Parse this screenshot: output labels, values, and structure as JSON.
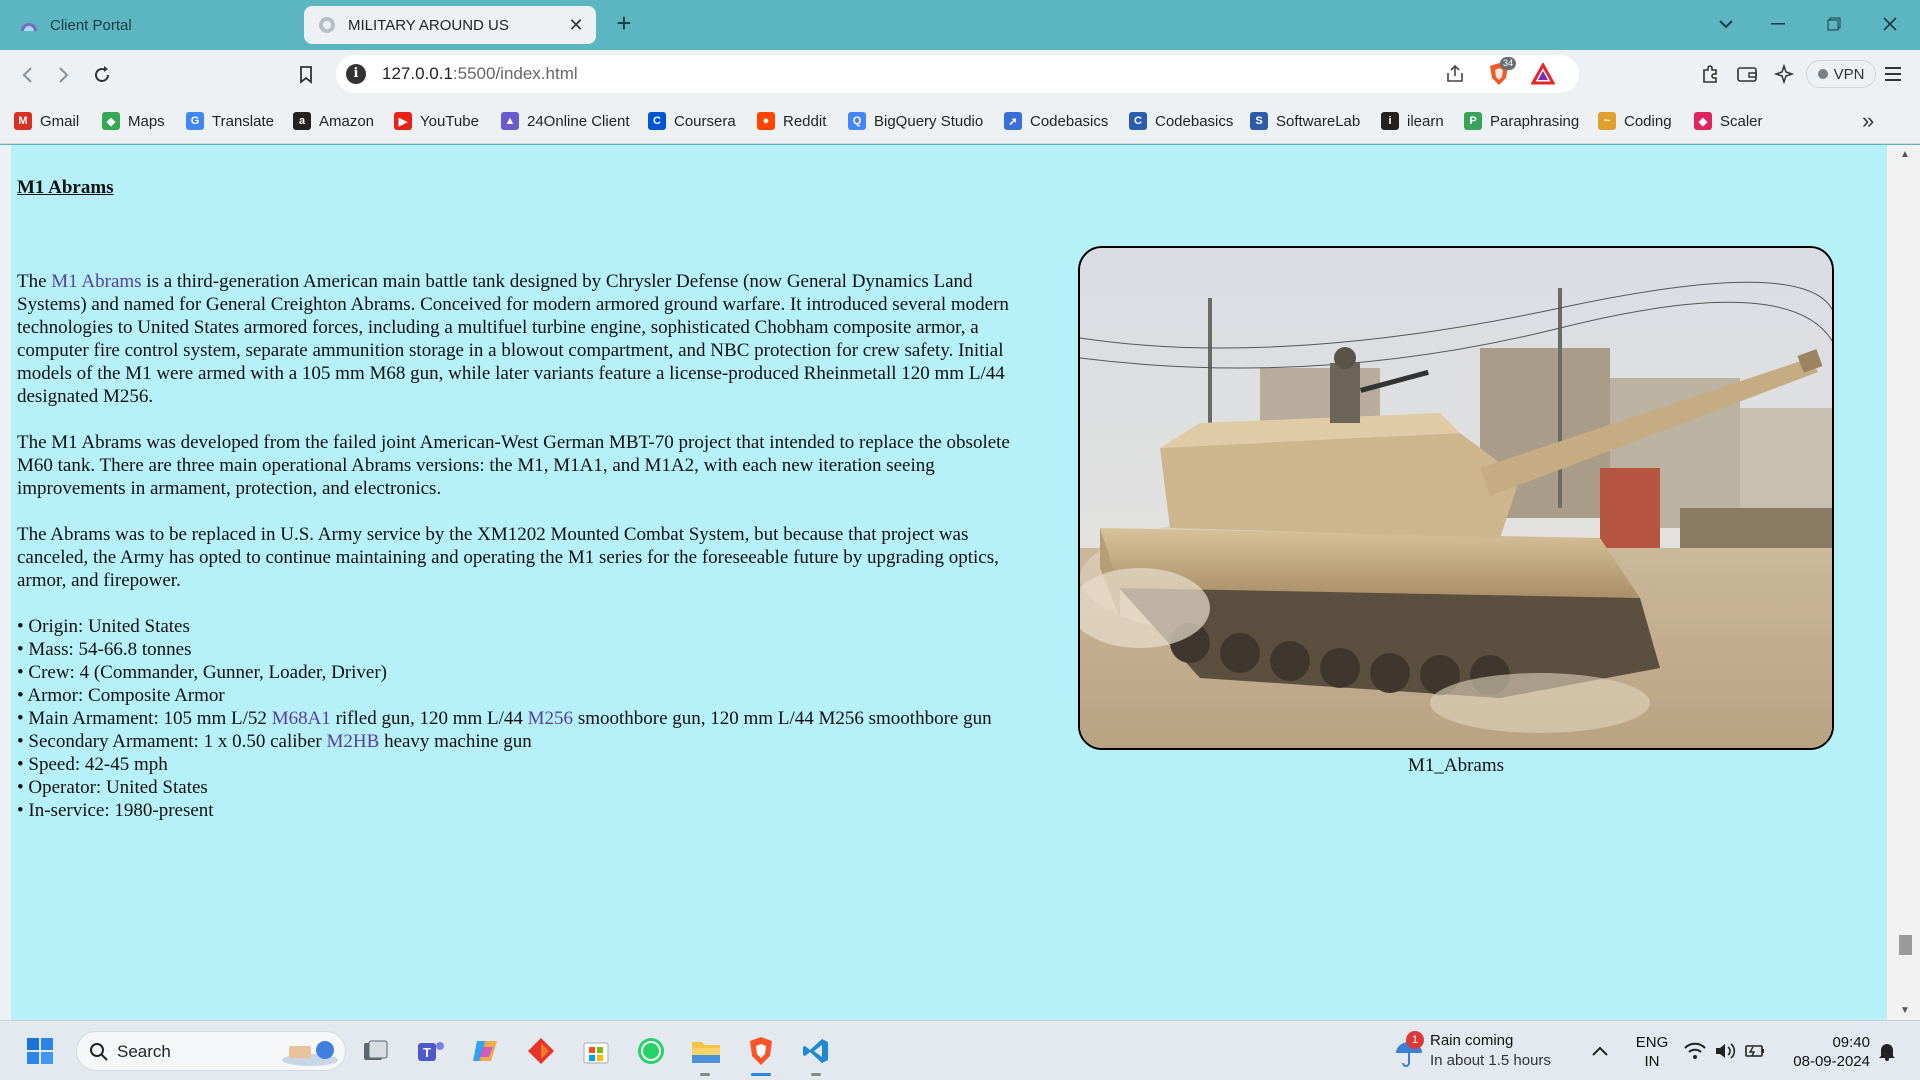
{
  "browser": {
    "tabs": [
      {
        "title": "Client Portal",
        "active": false
      },
      {
        "title": "MILITARY AROUND US",
        "active": true
      }
    ],
    "close_tab_symbol": "✕",
    "new_tab_symbol": "+",
    "url_host": "127.0.0.1",
    "url_rest": ":5500/index.html",
    "shield_count": "34",
    "vpn_label": "VPN"
  },
  "bookmarks": [
    {
      "label": "Gmail",
      "icon": "gmail-icon",
      "color": "#d93025",
      "glyph": "M"
    },
    {
      "label": "Maps",
      "icon": "maps-icon",
      "color": "#34a853",
      "glyph": "◆"
    },
    {
      "label": "Translate",
      "icon": "translate-icon",
      "color": "#4285f4",
      "glyph": "G"
    },
    {
      "label": "Amazon",
      "icon": "amazon-icon",
      "color": "#222222",
      "glyph": "a"
    },
    {
      "label": "YouTube",
      "icon": "youtube-icon",
      "color": "#e62117",
      "glyph": "▶"
    },
    {
      "label": "24Online Client",
      "icon": "24online-icon",
      "color": "#6a5acd",
      "glyph": "▲"
    },
    {
      "label": "Coursera",
      "icon": "coursera-icon",
      "color": "#0056d2",
      "glyph": "C"
    },
    {
      "label": "Reddit",
      "icon": "reddit-icon",
      "color": "#ff4500",
      "glyph": "●"
    },
    {
      "label": "BigQuery Studio",
      "icon": "bigquery-icon",
      "color": "#4386fa",
      "glyph": "Q"
    },
    {
      "label": "Codebasics",
      "icon": "codebasics-rocket-icon",
      "color": "#3b6fd8",
      "glyph": "➚"
    },
    {
      "label": "Codebasics",
      "icon": "codebasics-icon",
      "color": "#2a5db0",
      "glyph": "C"
    },
    {
      "label": "SoftwareLab",
      "icon": "softwarelab-icon",
      "color": "#2f5aa8",
      "glyph": "S"
    },
    {
      "label": "ilearn",
      "icon": "ilearn-icon",
      "color": "#222222",
      "glyph": "i"
    },
    {
      "label": "Paraphrasing",
      "icon": "paraphrasing-icon",
      "color": "#3aa35b",
      "glyph": "P"
    },
    {
      "label": "Coding",
      "icon": "coding-icon",
      "color": "#e0a030",
      "glyph": "~"
    },
    {
      "label": "Scaler",
      "icon": "scaler-icon",
      "color": "#e0245e",
      "glyph": "◆"
    }
  ],
  "bookmarks_more": "»",
  "page": {
    "title": "M1 Abrams",
    "p1": {
      "before": "The ",
      "link": "M1 Abrams",
      "after": " is a third-generation American main battle tank designed by Chrysler Defense (now General Dynamics Land Systems) and named for General Creighton Abrams. Conceived for modern armored ground warfare. It introduced several modern technologies to United States armored forces, including a multifuel turbine engine, sophisticated Chobham composite armor, a computer fire control system, separate ammunition storage in a blowout compartment, and NBC protection for crew safety. Initial models of the M1 were armed with a 105 mm M68 gun, while later variants feature a license-produced Rheinmetall 120 mm L/44 designated M256."
    },
    "p2": "The M1 Abrams was developed from the failed joint American-West German MBT-70 project that intended to replace the obsolete M60 tank. There are three main operational Abrams versions: the M1, M1A1, and M1A2, with each new iteration seeing improvements in armament, protection, and electronics.",
    "p3": "The Abrams was to be replaced in U.S. Army service by the XM1202 Mounted Combat System, but because that project was canceled, the Army has opted to continue maintaining and operating the M1 series for the foreseeable future by upgrading optics, armor, and firepower.",
    "specs": {
      "origin": "• Origin: United States",
      "mass": "• Mass: 54-66.8 tonnes",
      "crew": "• Crew: 4 (Commander, Gunner, Loader, Driver)",
      "armor": "• Armor: Composite Armor",
      "main_arm_a": "• Main Armament: 105 mm L/52 ",
      "main_arm_link1": "M68A1",
      "main_arm_b": " rifled gun, 120 mm L/44 ",
      "main_arm_link2": "M256",
      "main_arm_c": " smoothbore gun, 120 mm L/44 M256 smoothbore gun",
      "sec_arm_a": "• Secondary Armament: 1 x 0.50 caliber ",
      "sec_arm_link": "M2HB",
      "sec_arm_b": " heavy machine gun",
      "speed": "• Speed: 42-45 mph",
      "operator": "• Operator: United States",
      "service": "• In-service: 1980-present"
    },
    "image_caption": "M1_Abrams"
  },
  "taskbar": {
    "search_label": "Search",
    "weather_title": "Rain coming",
    "weather_sub": "In about 1.5 hours",
    "weather_badge": "1",
    "lang_top": "ENG",
    "lang_bottom": "IN",
    "time": "09:40",
    "date": "08-09-2024"
  }
}
